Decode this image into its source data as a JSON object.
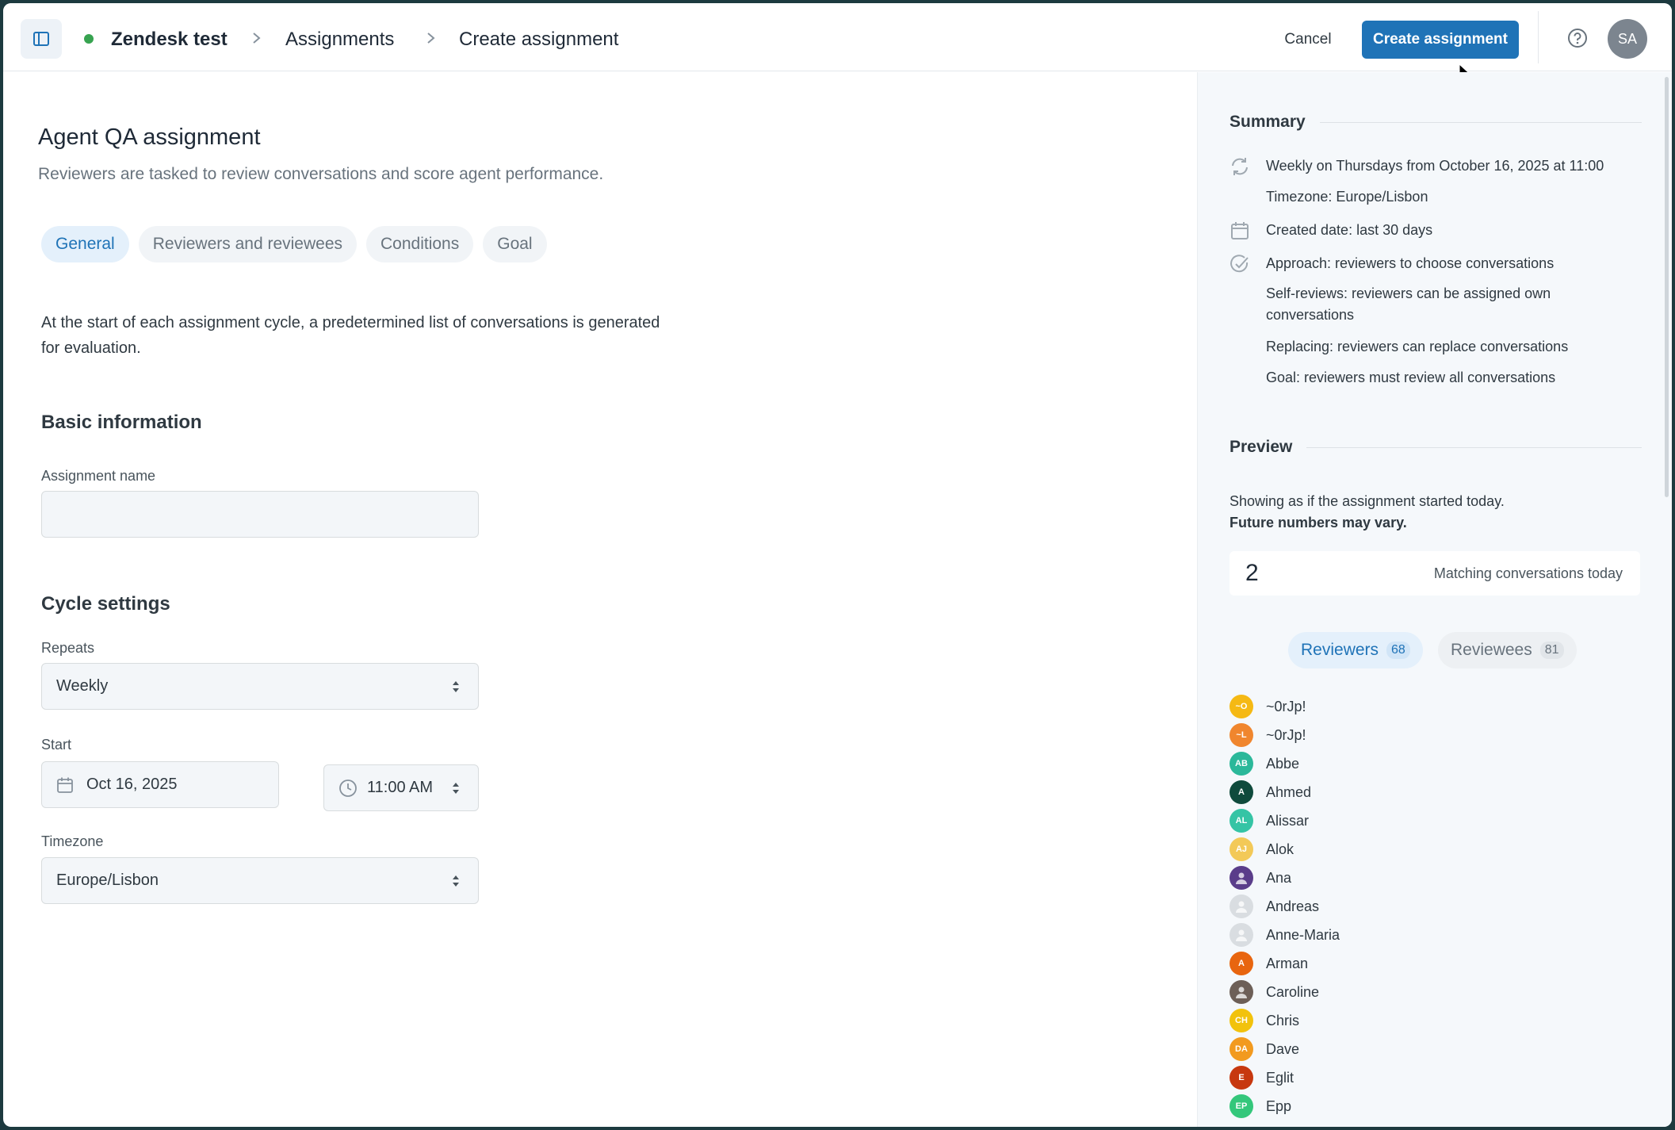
{
  "header": {
    "breadcrumb": [
      "Zendesk test",
      "Assignments",
      "Create assignment"
    ],
    "cancel_label": "Cancel",
    "create_label": "Create assignment",
    "avatar_initials": "SA",
    "status_color": "#37a350",
    "accent_color": "#1f73b7"
  },
  "main": {
    "title": "Agent QA assignment",
    "description": "Reviewers are tasked to review conversations and score agent performance.",
    "tabs": [
      "General",
      "Reviewers and reviewees",
      "Conditions",
      "Goal"
    ],
    "active_tab": "General",
    "intro": "At the start of each assignment cycle, a predetermined list of conversations is generated for evaluation.",
    "basic_info": {
      "title": "Basic information",
      "name_label": "Assignment name",
      "name_value": ""
    },
    "cycle": {
      "title": "Cycle settings",
      "repeats_label": "Repeats",
      "repeats_value": "Weekly",
      "start_label": "Start",
      "start_date": "Oct 16, 2025",
      "start_time": "11:00 AM",
      "timezone_label": "Timezone",
      "timezone_value": "Europe/Lisbon"
    }
  },
  "summary": {
    "title": "Summary",
    "schedule": "Weekly on Thursdays from October 16, 2025 at 11:00",
    "timezone": "Timezone: Europe/Lisbon",
    "created": "Created date: last 30 days",
    "approach": "Approach: reviewers to choose conversations",
    "self_reviews": "Self-reviews: reviewers can be assigned own conversations",
    "replacing": "Replacing: reviewers can replace conversations",
    "goal": "Goal: reviewers must review all conversations"
  },
  "preview": {
    "title": "Preview",
    "line1": "Showing as if the assignment started today.",
    "line2": "Future numbers may vary.",
    "count": "2",
    "count_label": "Matching conversations today",
    "reviewers_label": "Reviewers",
    "reviewers_count": "68",
    "reviewees_label": "Reviewees",
    "reviewees_count": "81",
    "people": [
      {
        "name": "~0rJp!",
        "initials": "~O",
        "color": "#f5b914"
      },
      {
        "name": "~0rJp!",
        "initials": "~L",
        "color": "#f0862e"
      },
      {
        "name": "Abbe",
        "initials": "AB",
        "color": "#2bb89a"
      },
      {
        "name": "Ahmed",
        "initials": "A",
        "color": "#0f4a3c"
      },
      {
        "name": "Alissar",
        "initials": "AL",
        "color": "#35c4a5"
      },
      {
        "name": "Alok",
        "initials": "AJ",
        "color": "#f3c958"
      },
      {
        "name": "Ana",
        "initials": "",
        "color": "#5a3d8a"
      },
      {
        "name": "Andreas",
        "initials": "",
        "color": "#d9dde1"
      },
      {
        "name": "Anne-Maria",
        "initials": "",
        "color": "#d9dde1"
      },
      {
        "name": "Arman",
        "initials": "A",
        "color": "#e8650f"
      },
      {
        "name": "Caroline",
        "initials": "",
        "color": "#6d5f57"
      },
      {
        "name": "Chris",
        "initials": "CH",
        "color": "#f2c20c"
      },
      {
        "name": "Dave",
        "initials": "DA",
        "color": "#f29a1f"
      },
      {
        "name": "Eglit",
        "initials": "E",
        "color": "#c7380f"
      },
      {
        "name": "Epp",
        "initials": "EP",
        "color": "#34c77b"
      }
    ]
  }
}
